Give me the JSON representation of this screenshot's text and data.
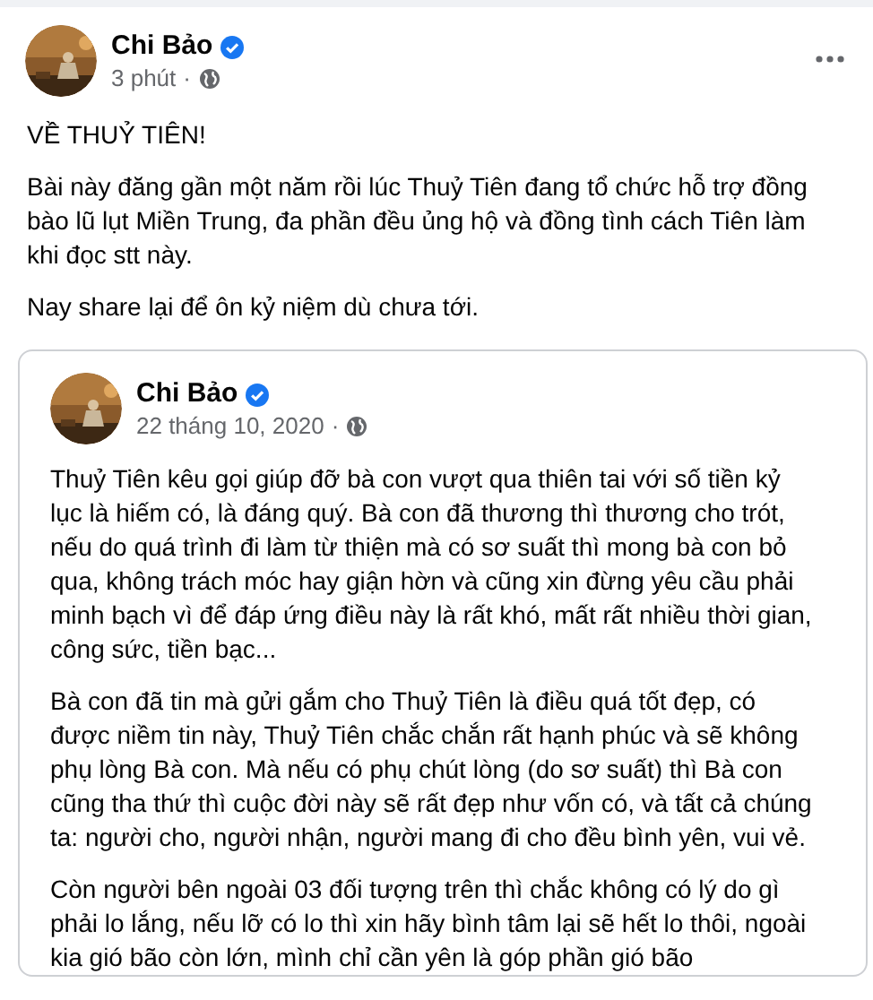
{
  "post": {
    "author": "Chi Bảo",
    "verified": true,
    "time": "3 phút",
    "separator": "·",
    "public": true,
    "paragraphs": [
      "VỀ THUỶ TIÊN!",
      "Bài này đăng gần một năm rồi lúc Thuỷ Tiên đang tổ chức hỗ trợ đồng bào lũ lụt Miền Trung, đa phần đều ủng hộ và đồng tình cách Tiên làm khi đọc stt này.",
      "Nay share lại để ôn kỷ niệm dù chưa tới."
    ]
  },
  "shared_post": {
    "author": "Chi Bảo",
    "verified": true,
    "time": "22 tháng 10, 2020",
    "separator": "·",
    "public": true,
    "paragraphs": [
      "Thuỷ Tiên kêu gọi giúp đỡ bà con vượt qua thiên tai với số tiền kỷ lục là hiếm có, là đáng quý. Bà con đã thương thì thương cho trót, nếu do quá trình đi làm từ thiện mà có sơ suất thì mong bà con bỏ qua, không trách móc hay giận hờn và cũng xin đừng yêu cầu phải minh bạch vì để đáp ứng điều này là rất khó, mất rất nhiều thời gian, công sức, tiền bạc...",
      "Bà con đã tin mà gửi gắm cho Thuỷ Tiên là điều quá tốt đẹp, có được niềm tin này, Thuỷ Tiên chắc chắn rất hạnh phúc và sẽ không phụ lòng Bà con. Mà nếu có phụ chút lòng (do sơ suất) thì Bà con cũng tha thứ thì cuộc đời này sẽ rất đẹp như vốn có, và tất cả chúng ta: người cho, người nhận, người mang đi cho đều bình yên, vui vẻ.",
      "Còn người bên ngoài 03 đối tượng trên thì chắc không có lý do gì phải lo lắng, nếu lỡ có lo thì xin hãy bình tâm lại sẽ hết lo thôi, ngoài kia gió bão còn lớn, mình chỉ cần yên là góp phần gió bão"
    ]
  }
}
